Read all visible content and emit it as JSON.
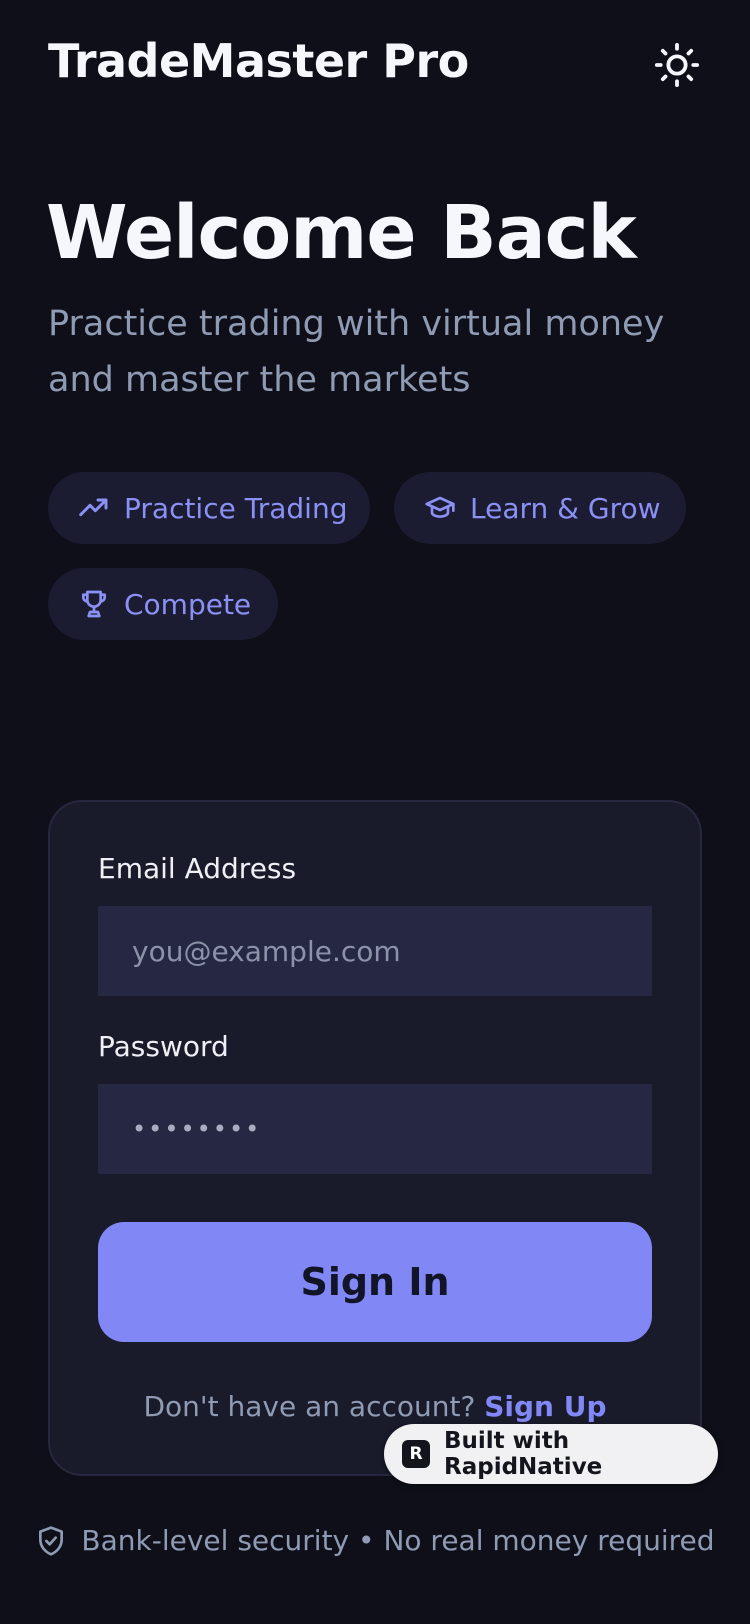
{
  "app": {
    "title": "TradeMaster Pro"
  },
  "header": {
    "theme_icon": "sun-icon"
  },
  "hero": {
    "title": "Welcome Back",
    "subtitle": "Practice trading with virtual money and master the markets"
  },
  "features": [
    {
      "label": "Practice Trading",
      "icon": "trending-up-icon"
    },
    {
      "label": "Learn & Grow",
      "icon": "graduation-cap-icon"
    },
    {
      "label": "Compete",
      "icon": "trophy-icon"
    }
  ],
  "form": {
    "email_label": "Email Address",
    "email_placeholder": "you@example.com",
    "password_label": "Password",
    "password_mask": "••••••••",
    "submit_label": "Sign In",
    "signup_prompt": "Don't have an account?",
    "signup_link": "Sign Up"
  },
  "badge": {
    "label": "Built with RapidNative",
    "logo_letter": "R"
  },
  "footer": {
    "text": "Bank-level security • No real money required",
    "icon": "shield-check-icon"
  },
  "colors": {
    "background": "#0f0f19",
    "card": "#191a2a",
    "input": "#262742",
    "accent": "#8188f6",
    "muted_text": "#8f9ab3"
  }
}
